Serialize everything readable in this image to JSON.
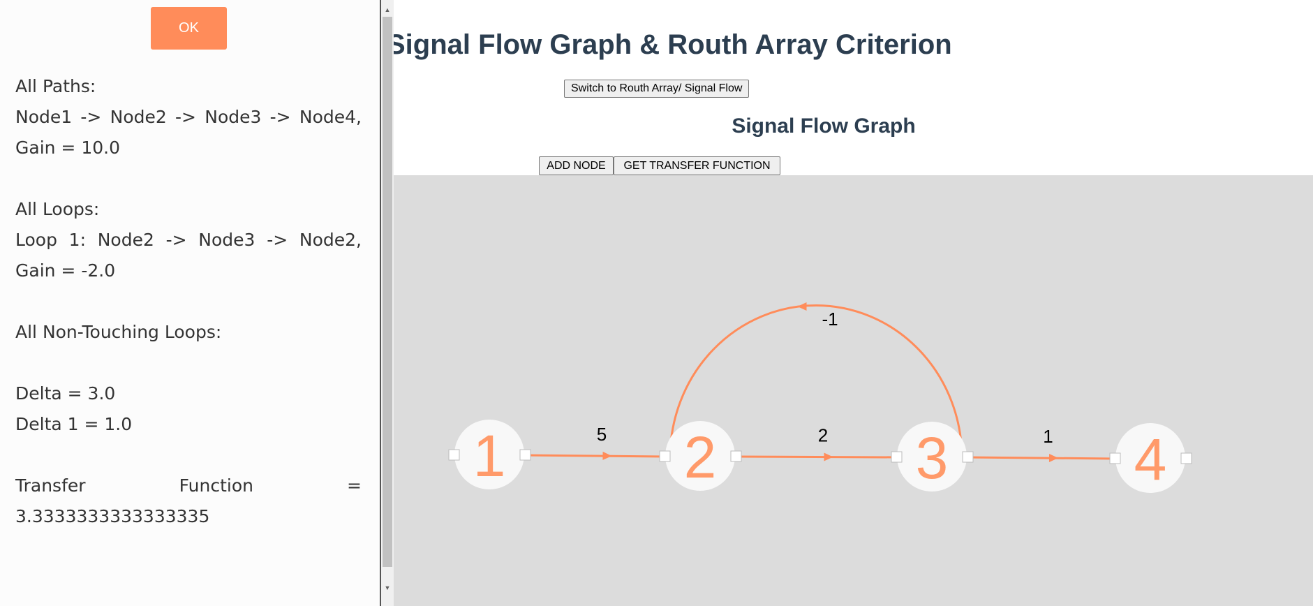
{
  "results_panel": {
    "ok_label": "OK",
    "lines": [
      "All Paths:",
      "Node1 -> Node2 -> Node3 -> Node4, Gain = 10.0",
      "",
      "All Loops:",
      "Loop 1: Node2 -> Node3 -> Node2, Gain = -2.0",
      "",
      "All Non-Touching Loops:",
      "",
      "Delta = 3.0",
      "Delta 1 = 1.0",
      "",
      "Transfer Function = 3.3333333333333335"
    ]
  },
  "header": {
    "title": "Signal Flow Graph & Routh Array Criterion",
    "switch_label": "Switch to Routh Array/ Signal Flow",
    "section_title": "Signal Flow Graph"
  },
  "toolbar": {
    "add_node_label": "ADD NODE",
    "transfer_label": "GET TRANSFER FUNCTION"
  },
  "graph": {
    "nodes": [
      {
        "id": "1",
        "label": "1"
      },
      {
        "id": "2",
        "label": "2"
      },
      {
        "id": "3",
        "label": "3"
      },
      {
        "id": "4",
        "label": "4"
      }
    ],
    "edges": [
      {
        "from": "1",
        "to": "2",
        "gain": "5"
      },
      {
        "from": "2",
        "to": "3",
        "gain": "2"
      },
      {
        "from": "3",
        "to": "4",
        "gain": "1"
      },
      {
        "from": "3",
        "to": "2",
        "gain": "-1"
      }
    ]
  },
  "colors": {
    "accent": "#ff8c5a",
    "canvas": "#dcdcdc",
    "heading": "#2c3e50"
  }
}
